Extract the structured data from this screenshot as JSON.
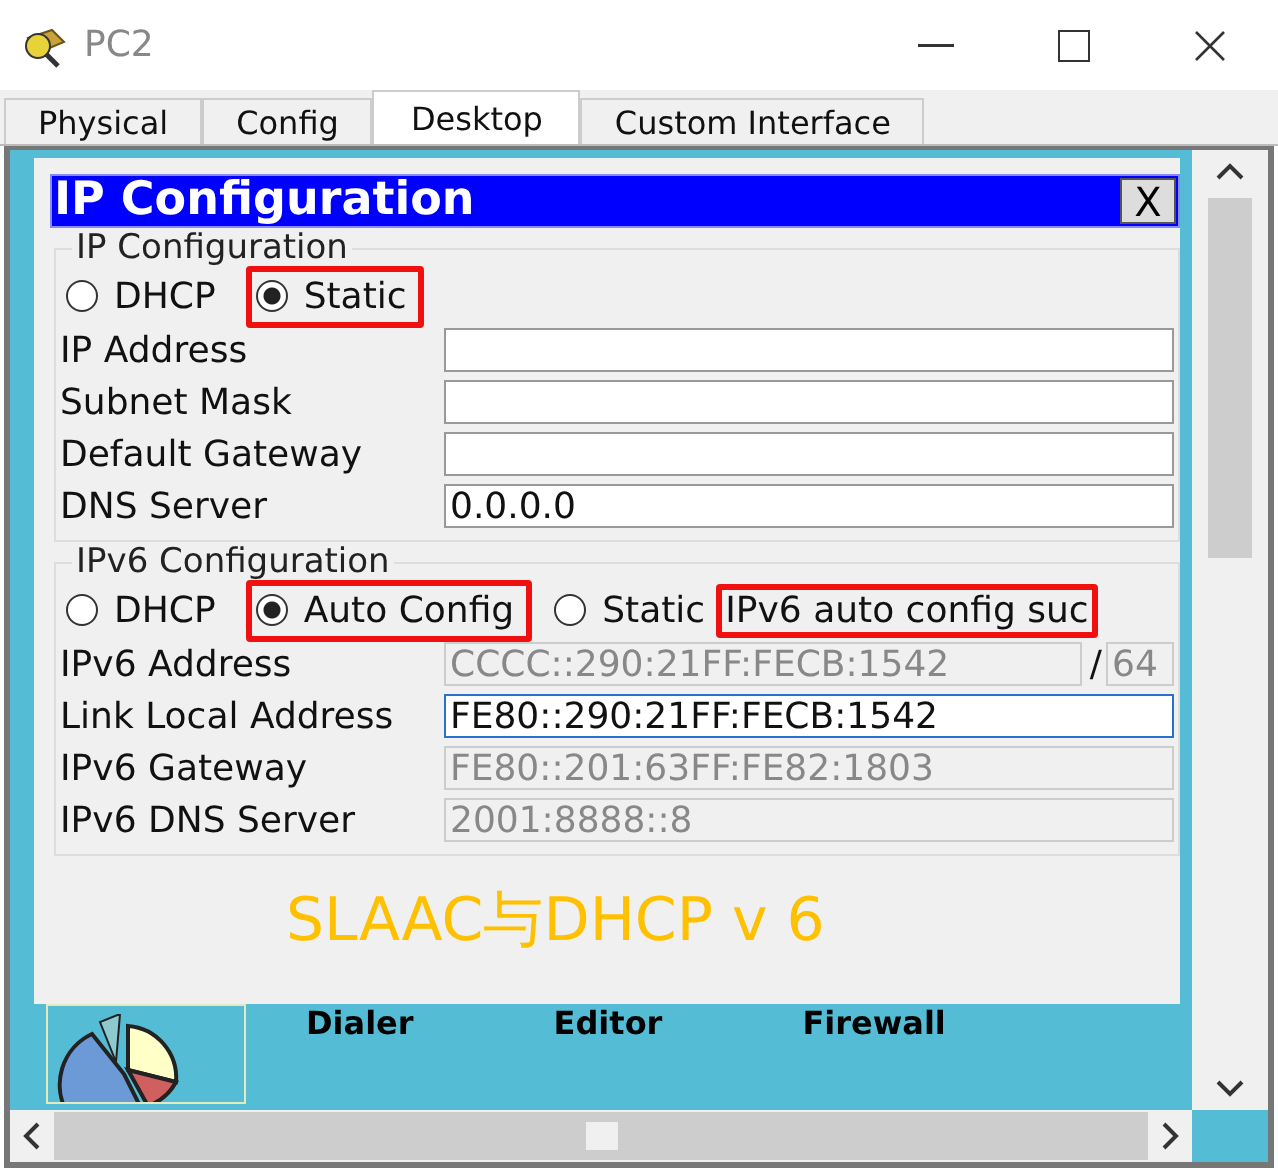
{
  "window": {
    "title": "PC2"
  },
  "tabs": [
    {
      "label": "Physical",
      "selected": false
    },
    {
      "label": "Config",
      "selected": false
    },
    {
      "label": "Desktop",
      "selected": true
    },
    {
      "label": "Custom Interface",
      "selected": false
    }
  ],
  "dialog": {
    "title": "IP Configuration",
    "close": "X",
    "ipv4": {
      "legend": "IP Configuration",
      "modes": [
        {
          "label": "DHCP",
          "selected": false,
          "highlighted": false
        },
        {
          "label": "Static",
          "selected": true,
          "highlighted": true
        }
      ],
      "fields": [
        {
          "label": "IP Address",
          "disabled": false,
          "focused": false
        },
        {
          "label": "Subnet Mask",
          "disabled": false,
          "focused": false
        },
        {
          "label": "Default Gateway",
          "disabled": false,
          "focused": false
        },
        {
          "label": "DNS Server",
          "value": "0.0.0.0",
          "disabled": false,
          "focused": false
        }
      ]
    },
    "ipv6": {
      "legend": "IPv6 Configuration",
      "modes": [
        {
          "label": "DHCP",
          "selected": false,
          "highlighted": false
        },
        {
          "label": "Auto Config",
          "selected": true,
          "highlighted": true
        },
        {
          "label": "Static",
          "selected": false,
          "highlighted": false
        }
      ],
      "status": {
        "text": "IPv6 auto config suc",
        "highlighted": true
      },
      "fields": [
        {
          "label": "IPv6 Address",
          "value": "CCCC::290:21FF:FECB:1542",
          "separator": "/",
          "prefix": "64",
          "disabled": true,
          "focused": false
        },
        {
          "label": "Link Local Address",
          "value": "FE80::290:21FF:FECB:1542",
          "disabled": false,
          "focused": true
        },
        {
          "label": "IPv6 Gateway",
          "value": "FE80::201:63FF:FE82:1803",
          "disabled": true,
          "focused": false
        },
        {
          "label": "IPv6 DNS Server",
          "value": "2001:8888::8",
          "disabled": true,
          "focused": false
        }
      ]
    },
    "annotation": "SLAAC与DHCP v 6"
  },
  "desktop_apps": [
    {
      "label": "Dialer"
    },
    {
      "label": "Editor"
    },
    {
      "label": "Firewall"
    }
  ]
}
